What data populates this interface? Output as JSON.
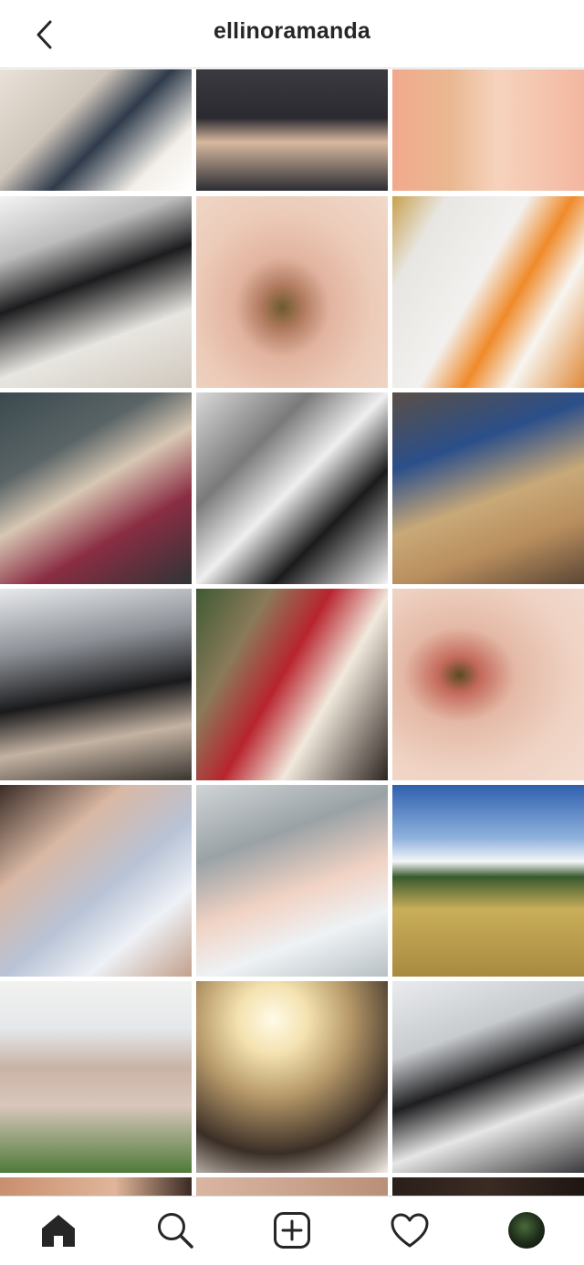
{
  "header": {
    "username": "ellinoramanda"
  },
  "icons": {
    "back": "chevron-left-icon",
    "home": "home-icon",
    "search": "search-icon",
    "new_post": "plus-square-icon",
    "activity": "heart-icon",
    "profile": "avatar"
  },
  "colors": {
    "text": "#262626",
    "divider": "#dbdbdb",
    "background": "#ffffff"
  }
}
